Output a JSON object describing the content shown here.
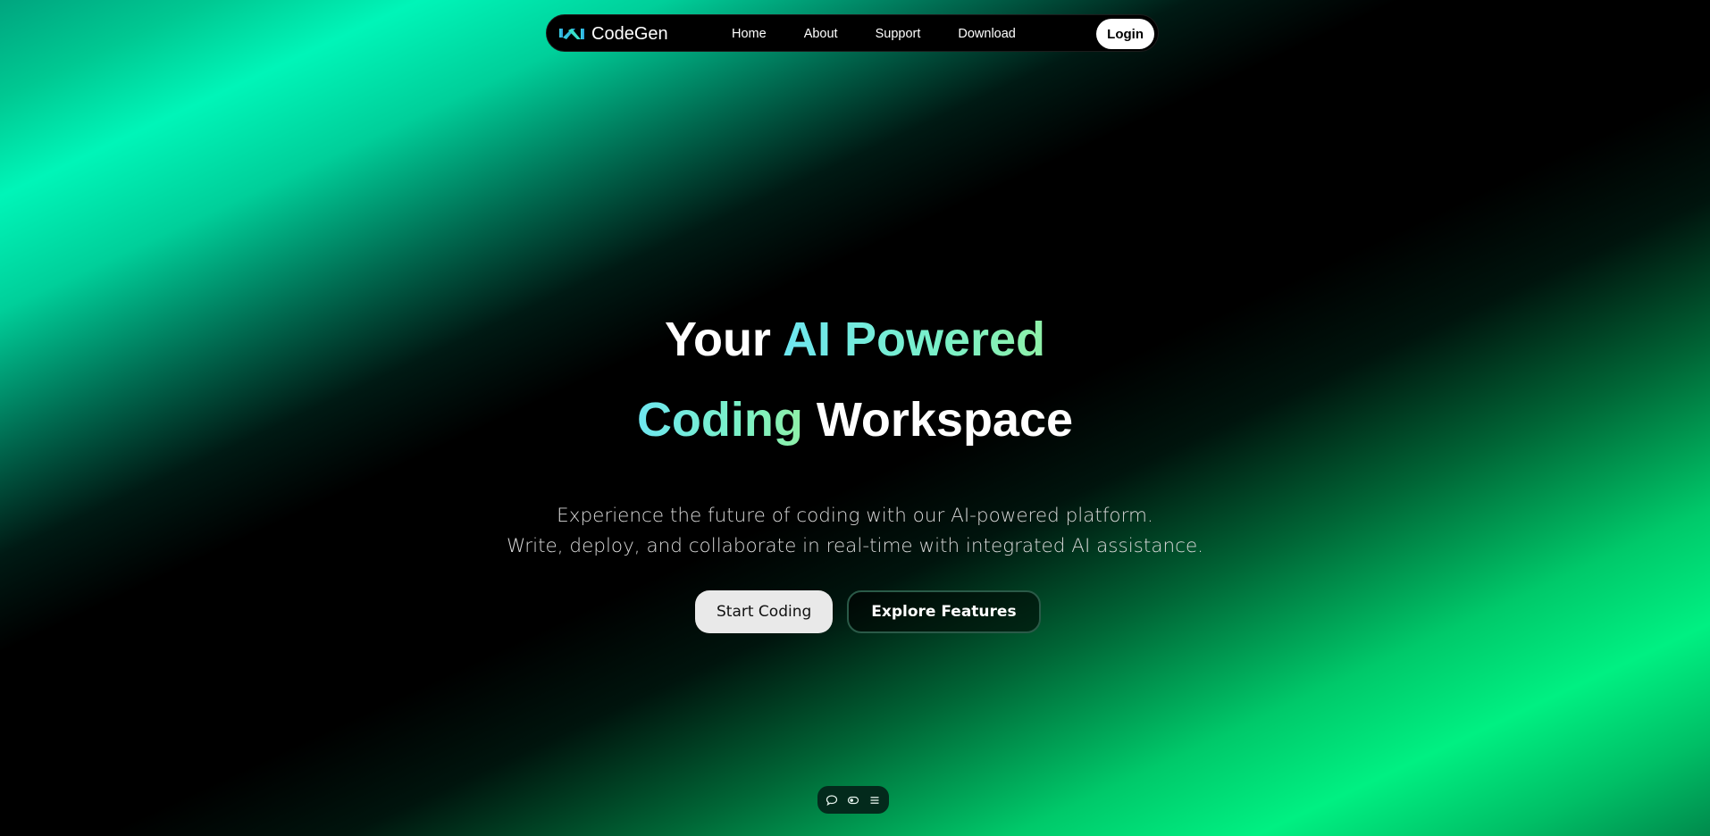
{
  "nav": {
    "brand": "CodeGen",
    "links": [
      "Home",
      "About",
      "Support",
      "Download"
    ],
    "login": "Login"
  },
  "hero": {
    "title_line1_plain": "Your ",
    "title_line1_accent": "AI Powered",
    "title_line2_accent": "Coding",
    "title_line2_plain": " Workspace",
    "subtitle_line1": "Experience the future of coding with our AI-powered platform.",
    "subtitle_line2": "Write, deploy, and collaborate in real-time with integrated AI assistance.",
    "primary_cta": "Start Coding",
    "secondary_cta": "Explore Features"
  },
  "dock": {
    "icons": [
      "chat-icon",
      "toggle-icon",
      "menu-icon"
    ]
  },
  "colors": {
    "accent_cyan": "#6ee6f0",
    "accent_green": "#8ff0a8",
    "glow_teal": "#00f5b8",
    "glow_green": "#00f082"
  }
}
